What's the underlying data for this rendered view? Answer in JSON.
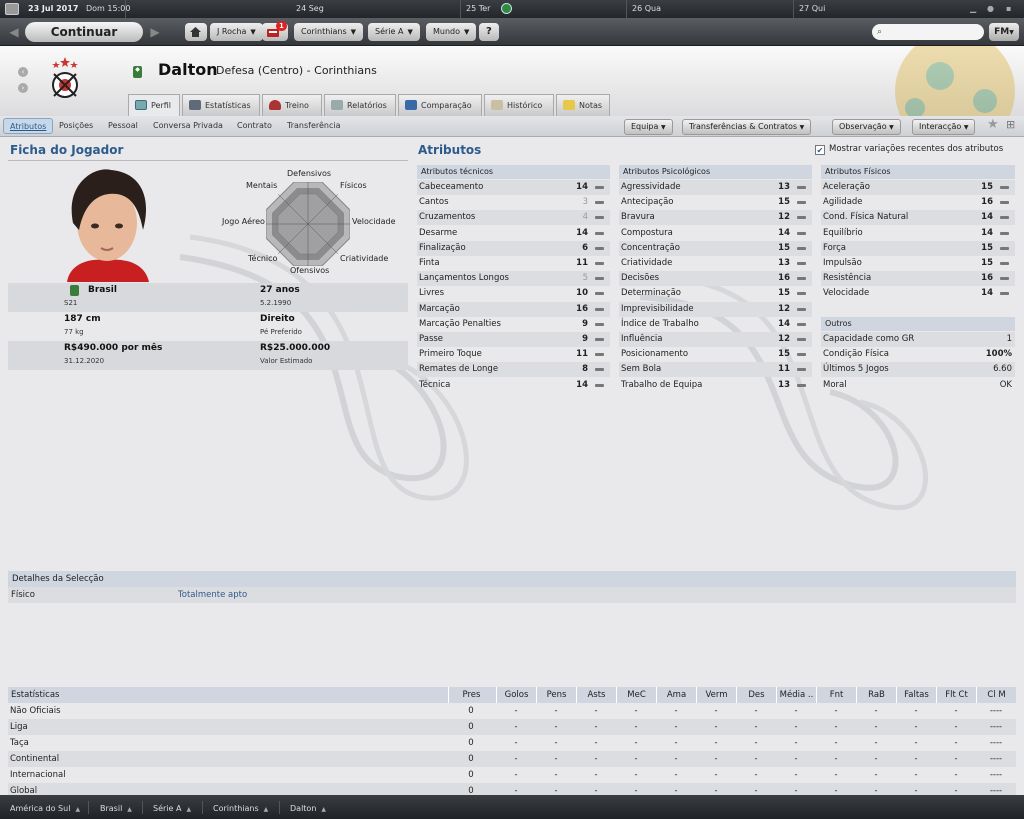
{
  "calendar": {
    "date": "23 Jul 2017",
    "time": "Dom 15:00",
    "days": [
      "24 Seg",
      "25 Ter",
      "26 Qua",
      "27 Qui"
    ]
  },
  "toolbar": {
    "continue_label": "Continuar",
    "manager": "J Rocha",
    "inbox_count": "1",
    "club": "Corinthians",
    "competition": "Série A",
    "world": "Mundo",
    "help": "?",
    "fm": "FM"
  },
  "player": {
    "name": "Dalton",
    "role": "Defesa (Centro) - Corinthians"
  },
  "tabs": [
    "Perfil",
    "Estatísticas",
    "Treino",
    "Relatórios",
    "Comparação",
    "Histórico",
    "Notas"
  ],
  "subtabs": [
    "Atributos",
    "Posições",
    "Pessoal",
    "Conversa Privada",
    "Contrato",
    "Transferência"
  ],
  "actions": [
    "Equipa",
    "Transferências & Contratos",
    "Observação",
    "Interacção"
  ],
  "profile": {
    "title": "Ficha do Jogador",
    "radar_labels": {
      "defensivos": "Defensivos",
      "fisicos": "Físicos",
      "velocidade": "Velocidade",
      "criatividade": "Criatividade",
      "ofensivos": "Ofensivos",
      "tecnico": "Técnico",
      "jogo_aereo": "Jogo Aéreo",
      "mentais": "Mentais"
    },
    "nation": "Brasil",
    "nation_sub": "S21",
    "age": "27 anos",
    "dob": "5.2.1990",
    "height": "187 cm",
    "weight": "77 kg",
    "foot": "Direito",
    "foot_label": "Pé Preferido",
    "wage": "R$490.000 por mês",
    "contract_end": "31.12.2020",
    "value": "R$25.000.000",
    "value_label": "Valor Estimado"
  },
  "attributes": {
    "title": "Atributos",
    "show_changes_label": "Mostrar variações recentes dos atributos",
    "show_changes": true,
    "technical": {
      "title": "Atributos técnicos",
      "items": [
        {
          "name": "Cabeceamento",
          "value": "14"
        },
        {
          "name": "Cantos",
          "value": "3"
        },
        {
          "name": "Cruzamentos",
          "value": "4"
        },
        {
          "name": "Desarme",
          "value": "14"
        },
        {
          "name": "Finalização",
          "value": "6"
        },
        {
          "name": "Finta",
          "value": "11"
        },
        {
          "name": "Lançamentos Longos",
          "value": "5"
        },
        {
          "name": "Livres",
          "value": "10"
        },
        {
          "name": "Marcação",
          "value": "16"
        },
        {
          "name": "Marcação Penalties",
          "value": "9"
        },
        {
          "name": "Passe",
          "value": "9"
        },
        {
          "name": "Primeiro Toque",
          "value": "11"
        },
        {
          "name": "Remates de Longe",
          "value": "8"
        },
        {
          "name": "Técnica",
          "value": "14"
        }
      ]
    },
    "mental": {
      "title": "Atributos Psicológicos",
      "items": [
        {
          "name": "Agressividade",
          "value": "13"
        },
        {
          "name": "Antecipação",
          "value": "15"
        },
        {
          "name": "Bravura",
          "value": "12"
        },
        {
          "name": "Compostura",
          "value": "14"
        },
        {
          "name": "Concentração",
          "value": "15"
        },
        {
          "name": "Criatividade",
          "value": "13"
        },
        {
          "name": "Decisões",
          "value": "16"
        },
        {
          "name": "Determinação",
          "value": "15"
        },
        {
          "name": "Imprevisibilidade",
          "value": "12"
        },
        {
          "name": "Índice de Trabalho",
          "value": "14"
        },
        {
          "name": "Influência",
          "value": "12"
        },
        {
          "name": "Posicionamento",
          "value": "15"
        },
        {
          "name": "Sem Bola",
          "value": "11"
        },
        {
          "name": "Trabalho de Equipa",
          "value": "13"
        }
      ]
    },
    "physical": {
      "title": "Atributos Físicos",
      "items": [
        {
          "name": "Aceleração",
          "value": "15"
        },
        {
          "name": "Agilidade",
          "value": "16"
        },
        {
          "name": "Cond. Física Natural",
          "value": "14"
        },
        {
          "name": "Equilíbrio",
          "value": "14"
        },
        {
          "name": "Força",
          "value": "15"
        },
        {
          "name": "Impulsão",
          "value": "15"
        },
        {
          "name": "Resistência",
          "value": "16"
        },
        {
          "name": "Velocidade",
          "value": "14"
        }
      ]
    },
    "other": {
      "title": "Outros",
      "items": [
        {
          "name": "Capacidade como GR",
          "value": "1"
        },
        {
          "name": "Condição Física",
          "value": "100%"
        },
        {
          "name": "Últimos 5 Jogos",
          "value": "6.60"
        },
        {
          "name": "Moral",
          "value": "OK"
        }
      ]
    }
  },
  "selection": {
    "title": "Detalhes da Selecção",
    "label": "Físico",
    "value": "Totalmente apto"
  },
  "stats": {
    "columns": [
      "Estatísticas",
      "Pres",
      "Golos",
      "Pens",
      "Asts",
      "MeC",
      "Ama",
      "Verm",
      "Des",
      "Média ..",
      "Fnt",
      "RaB",
      "Faltas",
      "Flt Ct",
      "Cl M"
    ],
    "rows": [
      [
        "Não Oficiais",
        "0",
        "-",
        "-",
        "-",
        "-",
        "-",
        "-",
        "-",
        "-",
        "-",
        "-",
        "-",
        "-",
        "----"
      ],
      [
        "Liga",
        "0",
        "-",
        "-",
        "-",
        "-",
        "-",
        "-",
        "-",
        "-",
        "-",
        "-",
        "-",
        "-",
        "----"
      ],
      [
        "Taça",
        "0",
        "-",
        "-",
        "-",
        "-",
        "-",
        "-",
        "-",
        "-",
        "-",
        "-",
        "-",
        "-",
        "----"
      ],
      [
        "Continental",
        "0",
        "-",
        "-",
        "-",
        "-",
        "-",
        "-",
        "-",
        "-",
        "-",
        "-",
        "-",
        "-",
        "----"
      ],
      [
        "Internacional",
        "0",
        "-",
        "-",
        "-",
        "-",
        "-",
        "-",
        "-",
        "-",
        "-",
        "-",
        "-",
        "-",
        "----"
      ],
      [
        "Global",
        "0",
        "-",
        "-",
        "-",
        "-",
        "-",
        "-",
        "-",
        "-",
        "-",
        "-",
        "-",
        "-",
        "----"
      ]
    ]
  },
  "breadcrumbs": [
    "América do Sul",
    "Brasil",
    "Série A",
    "Corinthians",
    "Dalton"
  ]
}
